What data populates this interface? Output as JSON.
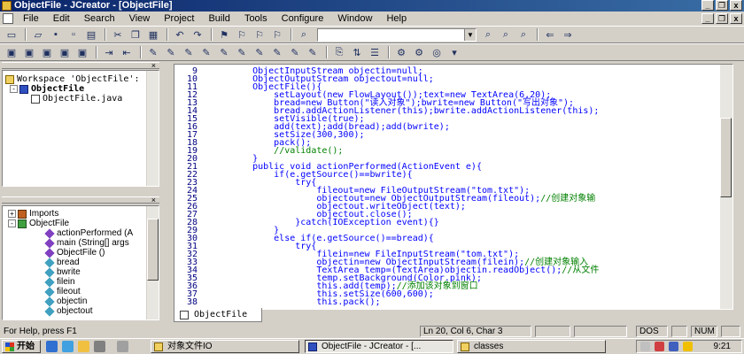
{
  "window": {
    "title": "ObjectFile - JCreator - [ObjectFile]",
    "controls": {
      "minimize": "_",
      "restore": "❐",
      "close": "x"
    },
    "doc_controls": {
      "minimize": "_",
      "restore": "❐",
      "close": "x"
    }
  },
  "menu": [
    "File",
    "Edit",
    "Search",
    "View",
    "Project",
    "Build",
    "Tools",
    "Configure",
    "Window",
    "Help"
  ],
  "workspace": {
    "root": "Workspace 'ObjectFile':",
    "project": "ObjectFile",
    "file": "ObjectFile.java"
  },
  "classview": {
    "items": [
      {
        "label": "Imports",
        "icon": "imports-icon",
        "expander": "+"
      },
      {
        "label": "ObjectFile",
        "icon": "class-icon",
        "expander": "-"
      },
      {
        "label": "actionPerformed (A",
        "icon": "method-icon"
      },
      {
        "label": "main (String[] args",
        "icon": "method-icon"
      },
      {
        "label": "ObjectFile ()",
        "icon": "method-icon"
      },
      {
        "label": "bread",
        "icon": "field-icon"
      },
      {
        "label": "bwrite",
        "icon": "field-icon"
      },
      {
        "label": "filein",
        "icon": "field-icon"
      },
      {
        "label": "fileout",
        "icon": "field-icon"
      },
      {
        "label": "objectin",
        "icon": "field-icon"
      },
      {
        "label": "objectout",
        "icon": "field-icon"
      }
    ]
  },
  "editor": {
    "tab": "ObjectFile",
    "lines": [
      {
        "n": "9",
        "code": "    ObjectInputStream objectin=null;"
      },
      {
        "n": "10",
        "code": "    ObjectOutputStream objectout=null;"
      },
      {
        "n": "11",
        "code": "    ObjectFile(){"
      },
      {
        "n": "12",
        "code": "        setLayout(new FlowLayout());text=new TextArea(6,20);"
      },
      {
        "n": "13",
        "code": "        bread=new Button(\"读入对象\");bwrite=new Button(\"写出对象\");"
      },
      {
        "n": "14",
        "code": "        bread.addActionListener(this);bwrite.addActionListener(this);"
      },
      {
        "n": "15",
        "code": "        setVisible(true);"
      },
      {
        "n": "16",
        "code": "        add(text);add(bread);add(bwrite);"
      },
      {
        "n": "17",
        "code": "        setSize(300,300);"
      },
      {
        "n": "18",
        "code": "        pack();"
      },
      {
        "n": "19",
        "code": "        ",
        "comment": "//validate();"
      },
      {
        "n": "20",
        "code": "    }"
      },
      {
        "n": "21",
        "code": "    public void actionPerformed(ActionEvent e){"
      },
      {
        "n": "22",
        "code": "        if(e.getSource()==bwrite){"
      },
      {
        "n": "23",
        "code": "            try{"
      },
      {
        "n": "24",
        "code": "                fileout=new FileOutputStream(\"tom.txt\");"
      },
      {
        "n": "25",
        "code": "                objectout=new ObjectOutputStream(fileout);",
        "comment": "//创建对象输"
      },
      {
        "n": "26",
        "code": "                objectout.writeObject(text);"
      },
      {
        "n": "27",
        "code": "                objectout.close();"
      },
      {
        "n": "28",
        "code": "            }catch(IOException event){}"
      },
      {
        "n": "29",
        "code": "        }"
      },
      {
        "n": "30",
        "code": "        else if(e.getSource()==bread){"
      },
      {
        "n": "31",
        "code": "            try{"
      },
      {
        "n": "32",
        "code": "                filein=new FileInputStream(\"tom.txt\");"
      },
      {
        "n": "33",
        "code": "                objectin=new ObjectInputStream(filein);",
        "comment": "//创建对象输入"
      },
      {
        "n": "34",
        "code": "                TextArea temp=(TextArea)objectin.readObject();",
        "comment": "//从文件"
      },
      {
        "n": "35",
        "code": "                temp.setBackground(Color.pink);"
      },
      {
        "n": "36",
        "code": "                this.add(temp);",
        "comment": "//添加该对象到窗口"
      },
      {
        "n": "37",
        "code": "                this.setSize(600,600);"
      },
      {
        "n": "38",
        "code": "                this.pack();"
      }
    ]
  },
  "status": {
    "help": "For Help, press F1",
    "position": "Ln 20, Col 6, Char 3",
    "mode": "DOS",
    "num": "NUM"
  },
  "taskbar": {
    "start": "开始",
    "tasks": [
      {
        "label": "对象文件IO",
        "active": false
      },
      {
        "label": "ObjectFile - JCreator - [...",
        "active": true
      },
      {
        "label": "classes",
        "active": false
      }
    ],
    "clock": "9:21"
  },
  "colors": {
    "title_start": "#0a246a",
    "title_end": "#3a6ea5",
    "code_text": "#0000ff",
    "comment_text": "#008000",
    "line_number": "#000080"
  }
}
